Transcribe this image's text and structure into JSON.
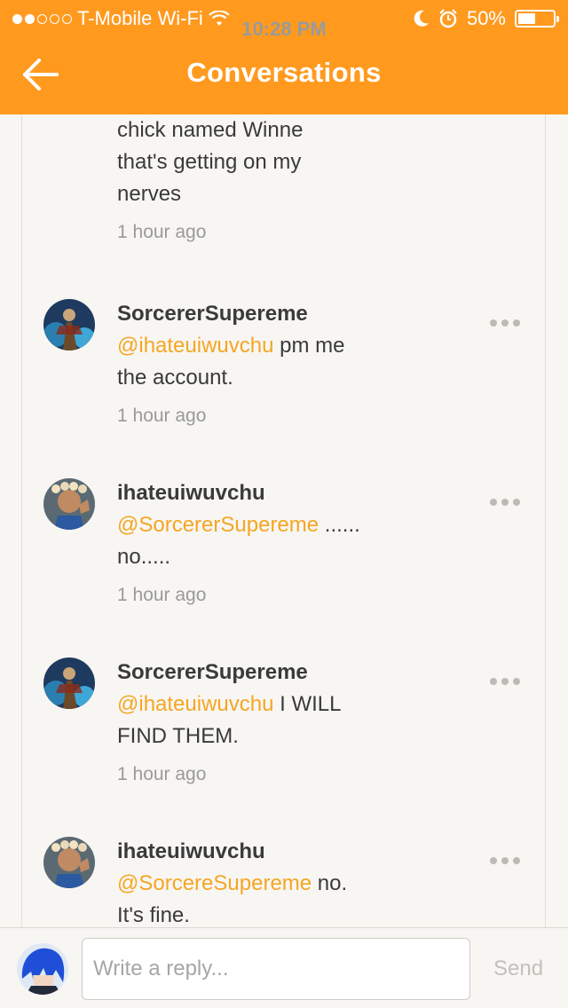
{
  "status_bar": {
    "carrier": "T-Mobile Wi-Fi",
    "time": "10:28 PM",
    "battery_percent": "50%",
    "battery_level": 0.5,
    "signal_bars_filled": 2,
    "signal_bars_total": 5,
    "icons": [
      "wifi-icon",
      "moon-icon",
      "alarm-icon",
      "battery-icon"
    ]
  },
  "header": {
    "title": "Conversations",
    "back_icon": "arrow-left-icon",
    "background": "#ff9a1f"
  },
  "comments": [
    {
      "username": "",
      "mention": "",
      "text_lines": [
        "chick named Winne",
        "that's getting on my",
        "nerves"
      ],
      "time": "1 hour ago",
      "partial": true
    },
    {
      "username": "SorcererSupereme",
      "mention": "@ihateuiwuvchu",
      "text_lines": [
        " pm me",
        "the account."
      ],
      "time": "1 hour ago",
      "avatar": "sorcerer"
    },
    {
      "username": "ihateuiwuvchu",
      "mention": "@SorcererSupereme",
      "text_lines": [
        " ......",
        "no....."
      ],
      "time": "1 hour ago",
      "avatar": "ihate"
    },
    {
      "username": "SorcererSupereme",
      "mention": "@ihateuiwuvchu",
      "text_lines": [
        " I WILL",
        "FIND THEM."
      ],
      "time": "1 hour ago",
      "avatar": "sorcerer"
    },
    {
      "username": "ihateuiwuvchu",
      "mention": "@SorcereSupereme",
      "text_lines": [
        " no.",
        "It's fine."
      ],
      "time": "",
      "avatar": "ihate"
    }
  ],
  "reply_bar": {
    "placeholder": "Write a reply...",
    "send_label": "Send"
  },
  "colors": {
    "accent": "#ff9a1f",
    "mention": "#f5a623",
    "text": "#3a3a3a",
    "muted": "#9a9a9a"
  }
}
